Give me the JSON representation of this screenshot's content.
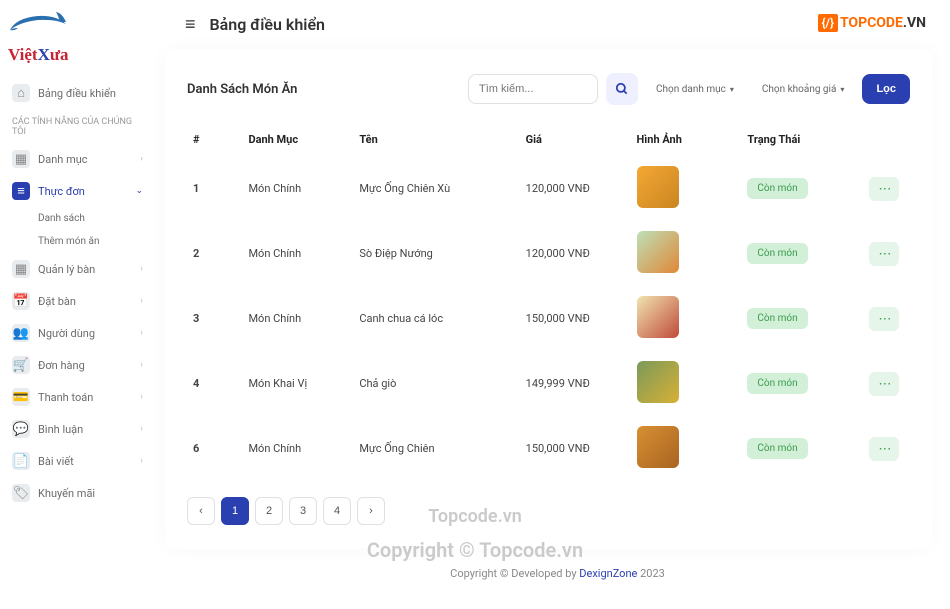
{
  "header": {
    "title": "Bảng điều khiển",
    "search_placeholder": "Tìm kiế"
  },
  "logo": {
    "viet": "Việt",
    "x": "X",
    "ua": "ưa"
  },
  "watermark_topcode": {
    "code": "TOPCODE",
    "vn": ".VN"
  },
  "watermark_center": "Topcode.vn",
  "watermark_copyright": "Copyright © Topcode.vn",
  "sidebar": {
    "dashboard": "Bảng điều khiển",
    "section_header": "CÁC TÍNH NĂNG CỦA CHÚNG TÔI",
    "items": [
      {
        "label": "Danh mục"
      },
      {
        "label": "Thực đơn"
      },
      {
        "label": "Quản lý bàn"
      },
      {
        "label": "Đặt bàn"
      },
      {
        "label": "Người dùng"
      },
      {
        "label": "Đơn hàng"
      },
      {
        "label": "Thanh toán"
      },
      {
        "label": "Bình luận"
      },
      {
        "label": "Bài viết"
      },
      {
        "label": "Khuyến mãi"
      }
    ],
    "sub": [
      "Danh sách",
      "Thêm món ăn"
    ]
  },
  "card": {
    "title": "Danh Sách Món Ăn",
    "search_placeholder": "Tìm kiếm...",
    "category_select": "Chọn danh mục",
    "price_select": "Chọn khoảng giá",
    "filter": "Lọc"
  },
  "table": {
    "headers": {
      "idx": "#",
      "category": "Danh Mục",
      "name": "Tên",
      "price": "Giá",
      "image": "Hình Ảnh",
      "status": "Trạng Thái"
    },
    "rows": [
      {
        "idx": "1",
        "category": "Món Chính",
        "name": "Mực Ống Chiên Xù",
        "price": "120,000 VNĐ",
        "status": "Còn món",
        "thumb": "thumb-1"
      },
      {
        "idx": "2",
        "category": "Món Chính",
        "name": "Sò Điệp Nướng",
        "price": "120,000 VNĐ",
        "status": "Còn món",
        "thumb": "thumb-2"
      },
      {
        "idx": "3",
        "category": "Món Chính",
        "name": "Canh chua cá lóc",
        "price": "150,000 VNĐ",
        "status": "Còn món",
        "thumb": "thumb-3"
      },
      {
        "idx": "4",
        "category": "Món Khai Vị",
        "name": "Chả giò",
        "price": "149,999 VNĐ",
        "status": "Còn món",
        "thumb": "thumb-4"
      },
      {
        "idx": "6",
        "category": "Món Chính",
        "name": "Mực Ống Chiên",
        "price": "150,000 VNĐ",
        "status": "Còn món",
        "thumb": "thumb-5"
      }
    ]
  },
  "pagination": {
    "prev": "‹",
    "pages": [
      "1",
      "2",
      "3",
      "4"
    ],
    "next": "›"
  },
  "footer": {
    "text": "Copyright © Developed by ",
    "brand": "DexignZone",
    "year": " 2023"
  }
}
